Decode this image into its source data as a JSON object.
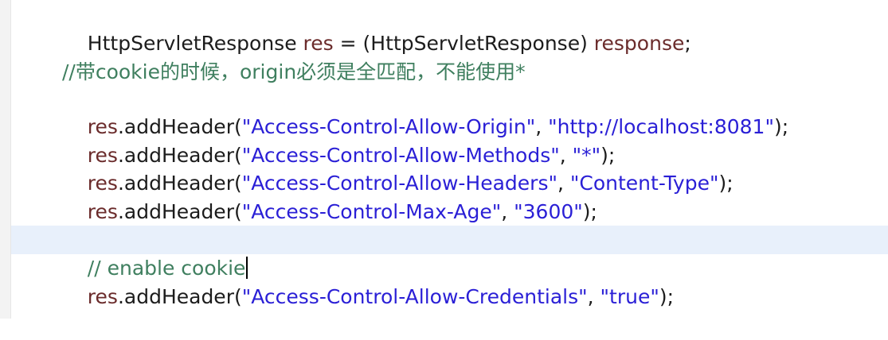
{
  "code": {
    "line1": {
      "type_a": "HttpServletResponse",
      "var_res": "res",
      "op": " = (",
      "type_b": "HttpServletResponse",
      "close": ") ",
      "var_response": "response",
      "end": ";"
    },
    "comment_cn": "//带cookie的时候，origin必须是全匹配，不能使用*",
    "origin": {
      "var": "res",
      "call": ".addHeader(",
      "key": "\"Access-Control-Allow-Origin\"",
      "sep": ", ",
      "value": "\"http://localhost:8081\"",
      "end": ");"
    },
    "methods": {
      "var": "res",
      "call": ".addHeader(",
      "key": "\"Access-Control-Allow-Methods\"",
      "sep": ", ",
      "value": "\"*\"",
      "end": ");"
    },
    "headers": {
      "var": "res",
      "call": ".addHeader(",
      "key": "\"Access-Control-Allow-Headers\"",
      "sep": ", ",
      "value": "\"Content-Type\"",
      "end": ");"
    },
    "maxage": {
      "var": "res",
      "call": ".addHeader(",
      "key": "\"Access-Control-Max-Age\"",
      "sep": ", ",
      "value": "\"3600\"",
      "end": ");"
    },
    "comment_en": "// enable cookie",
    "credentials": {
      "var": "res",
      "call": ".addHeader(",
      "key": "\"Access-Control-Allow-Credentials\"",
      "sep": ", ",
      "value": "\"true\"",
      "end": ");"
    }
  },
  "colors": {
    "string": "#2a1fd6",
    "variable": "#6b2c2c",
    "comment": "#3f7f5f",
    "current_line": "#e8f0fb"
  }
}
